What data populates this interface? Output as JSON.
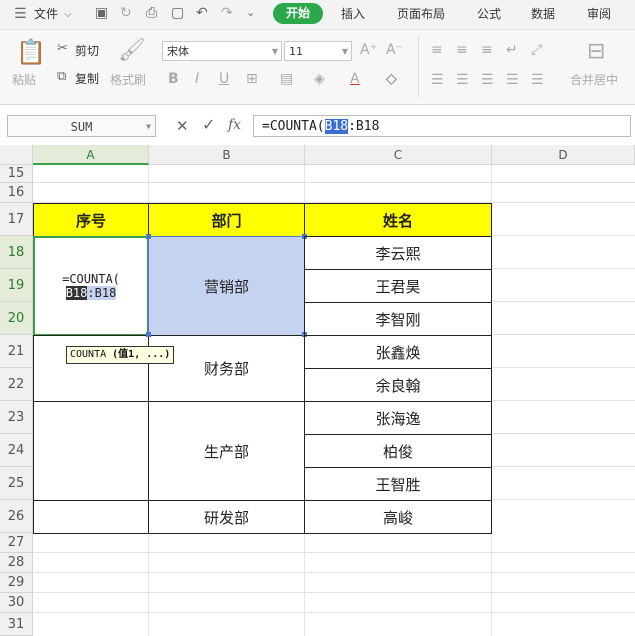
{
  "menubar": {
    "file_label": "文件",
    "tabs": [
      "开始",
      "插入",
      "页面布局",
      "公式",
      "数据",
      "审阅"
    ]
  },
  "ribbon": {
    "paste": "粘贴",
    "cut": "剪切",
    "copy": "复制",
    "format_painter": "格式刷",
    "font_name": "宋体",
    "font_size": "11",
    "bold": "B",
    "italic": "I",
    "underline": "U",
    "font_color": "A",
    "merge_center": "合并居中"
  },
  "formula_bar": {
    "name_box": "SUM",
    "fx": "fx",
    "formula_prefix": "=COUNTA(",
    "formula_highlight": "B18",
    "formula_suffix": ":B18"
  },
  "columns": [
    "A",
    "B",
    "C",
    "D"
  ],
  "rows": [
    "15",
    "16",
    "17",
    "18",
    "19",
    "20",
    "21",
    "22",
    "23",
    "24",
    "25",
    "26",
    "27",
    "28",
    "29",
    "30",
    "31"
  ],
  "table": {
    "header": {
      "seq": "序号",
      "dept": "部门",
      "name": "姓名"
    },
    "editing_cell": {
      "line1": "=COUNTA(",
      "ref_highlight": "B18",
      "ref_rest": ":B18"
    },
    "tooltip": {
      "func": "COUNTA",
      "args": "(值1, ...)"
    },
    "departments": [
      "营销部",
      "财务部",
      "生产部",
      "研发部"
    ],
    "names": [
      "李云熙",
      "王君昊",
      "李智刚",
      "张鑫焕",
      "余良翰",
      "张海逸",
      "柏俊",
      "王智胜",
      "高峻"
    ]
  },
  "colors": {
    "accent": "#2ba84a",
    "header_fill": "#ffff00",
    "selection": "#c5d3f0"
  }
}
